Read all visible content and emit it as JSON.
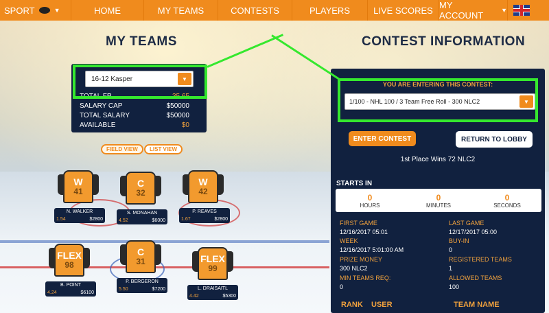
{
  "nav": {
    "sport": "SPORT",
    "items": [
      "HOME",
      "MY TEAMS",
      "CONTESTS",
      "PLAYERS",
      "LIVE SCORES",
      "MY ACCOUNT"
    ]
  },
  "headings": {
    "my_teams": "MY TEAMS",
    "contest_info": "CONTEST INFORMATION"
  },
  "team": {
    "selected": "16-12 Kasper",
    "stats": [
      {
        "label": "TOTAL FP",
        "value": "35.65"
      },
      {
        "label": "SALARY CAP",
        "value": "$50000"
      },
      {
        "label": "TOTAL SALARY",
        "value": "$50000"
      },
      {
        "label": "AVAILABLE",
        "value": "$0"
      }
    ],
    "field_view": "FIELD VIEW",
    "list_view": "LIST VIEW"
  },
  "players": [
    {
      "pos": "W",
      "num": "41",
      "name": "N. WALKER",
      "fp": "1.54",
      "salary": "$2800"
    },
    {
      "pos": "C",
      "num": "32",
      "name": "S. MONAHAN",
      "fp": "4.52",
      "salary": "$6000"
    },
    {
      "pos": "W",
      "num": "42",
      "name": "P. REAVES",
      "fp": "1.67",
      "salary": "$2800"
    },
    {
      "pos": "FLEX",
      "num": "98",
      "name": "B. POINT",
      "fp": "4.24",
      "salary": "$6100"
    },
    {
      "pos": "C",
      "num": "31",
      "name": "P. BERGERON",
      "fp": "5.50",
      "salary": "$7200"
    },
    {
      "pos": "FLEX",
      "num": "99",
      "name": "L. DRAISAITL",
      "fp": "4.42",
      "salary": "$5300"
    }
  ],
  "contest": {
    "entering_label": "YOU ARE ENTERING THIS CONTEST:",
    "selected": "1/100 - NHL 100 / 3 Team Free Roll - 300 NLC2",
    "enter_button": "ENTER CONTEST",
    "lobby_button": "RETURN TO LOBBY",
    "prize_line": "1st Place Wins 72 NLC2",
    "starts_in": "STARTS IN",
    "countdown": [
      {
        "value": "0",
        "unit": "HOURS"
      },
      {
        "value": "0",
        "unit": "MINUTES"
      },
      {
        "value": "0",
        "unit": "SECONDS"
      }
    ],
    "details_left": [
      {
        "label": "FIRST GAME",
        "value": "12/16/2017 05:01"
      },
      {
        "label": "WEEK",
        "value": "12/16/2017 5:01:00 AM"
      },
      {
        "label": "PRIZE MONEY",
        "value": "300 NLC2"
      },
      {
        "label": "MIN TEAMS REQ:",
        "value": "0"
      }
    ],
    "details_right": [
      {
        "label": "LAST GAME",
        "value": "12/17/2017 05:00"
      },
      {
        "label": "BUY-IN",
        "value": "0"
      },
      {
        "label": "REGISTERED TEAMS",
        "value": "1"
      },
      {
        "label": "ALLOWED TEAMS",
        "value": "100"
      }
    ],
    "table_headers": [
      "RANK",
      "USER",
      "TEAM NAME"
    ]
  },
  "colors": {
    "accent": "#f08b1d",
    "panel": "#11213f",
    "highlight": "#35e82e"
  }
}
